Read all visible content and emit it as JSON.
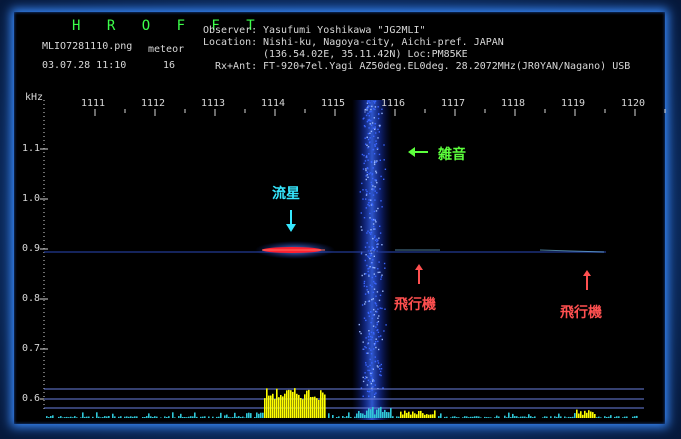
{
  "header": {
    "title": "H R O F F T",
    "filename": "MLIO7281110.png",
    "type": "meteor",
    "datetime": "03.07.28 11:10",
    "count": "16"
  },
  "info": {
    "observer_label": "Observer:",
    "observer": "Yasufumi Yoshikawa \"JG2MLI\"",
    "location_label": "Location:",
    "location": "Nishi-ku, Nagoya-city, Aichi-pref. JAPAN",
    "coords": "(136.54.02E, 35.11.42N) Loc:PM85KE",
    "rx_label": "Rx+Ant:",
    "rx": "FT-920+7el.Yagi AZ50deg.EL0deg. 28.2072MHz(JR0YAN/Nagano) USB"
  },
  "axes": {
    "ylabel": "kHz",
    "x_ticks": [
      "1111",
      "1112",
      "1113",
      "1114",
      "1115",
      "1116",
      "1117",
      "1118",
      "1119",
      "1120"
    ],
    "y_ticks": [
      "1.1",
      "1.0",
      "0.9",
      "0.8",
      "0.7",
      "0.6"
    ]
  },
  "annotations": {
    "meteor": "流星",
    "noise": "雑音",
    "aircraft1": "飛行機",
    "aircraft2": "飛行機"
  },
  "colors": {
    "title": "#3cff4a",
    "meteor_label": "#36e8ff",
    "noise_label": "#5cff3c",
    "aircraft_label": "#ff5050",
    "meteor_trace": "#ff2030",
    "baseline": "#ffff00"
  }
}
